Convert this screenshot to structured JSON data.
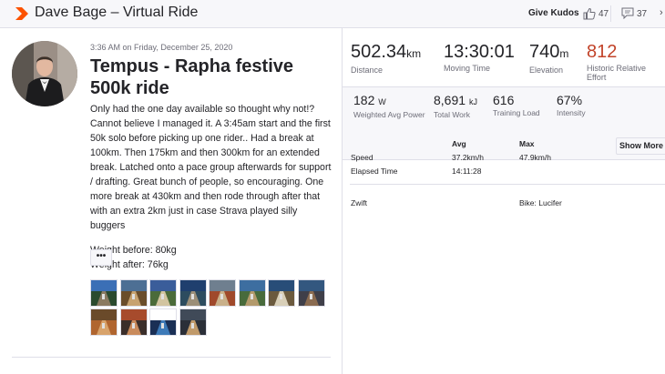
{
  "header": {
    "title": "Dave Bage – Virtual Ride",
    "give_kudos": "Give Kudos",
    "kudos_count": "47",
    "comment_count": "37",
    "more": "›"
  },
  "activity": {
    "date": "3:36 AM on Friday, December 25, 2020",
    "name": "Tempus - Rapha festive 500k ride",
    "description": [
      "Only had the one day available so thought why not!? Cannot believe I managed it. A 3:45am start and the first 50k solo before picking up one rider.. Had a break at 100km. Then 175km and then 300km for an extended break. Latched onto a pace group afterwards for support / drafting. Great bunch of people, so encouraging. One more break at 430km and then rode through after that with an extra 2km just in case Strava played silly buggers",
      "Weight before: 80kg\nWeight after: 76kg"
    ],
    "more_label": "•••",
    "photo_count": 12
  },
  "stats_primary": [
    {
      "value": "502.34",
      "unit": "km",
      "label": "Distance"
    },
    {
      "value": "13:30:01",
      "unit": "",
      "label": "Moving Time"
    },
    {
      "value": "740",
      "unit": "m",
      "label": "Elevation"
    },
    {
      "value": "812",
      "unit": "",
      "label": "Historic Relative Effort"
    }
  ],
  "stats_secondary": [
    {
      "value": "182",
      "unit": "W",
      "label": "Weighted Avg Power"
    },
    {
      "value": "8,691",
      "unit": "kJ",
      "label": "Total Work"
    },
    {
      "value": "616",
      "unit": "",
      "label": "Training Load"
    },
    {
      "value": "67%",
      "unit": "",
      "label": "Intensity"
    }
  ],
  "table": {
    "col_avg": "Avg",
    "col_max": "Max",
    "show_more": "Show More",
    "rows": [
      {
        "label": "Speed",
        "avg": "37.2km/h",
        "max": "47.9km/h"
      },
      {
        "label": "Elapsed Time",
        "avg": "14:11:28",
        "max": ""
      }
    ]
  },
  "footer": {
    "device": "Zwift",
    "bike": "Bike: Lucifer"
  },
  "colors": {
    "accent": "#fc5200",
    "relative_effort": "#c24329"
  }
}
